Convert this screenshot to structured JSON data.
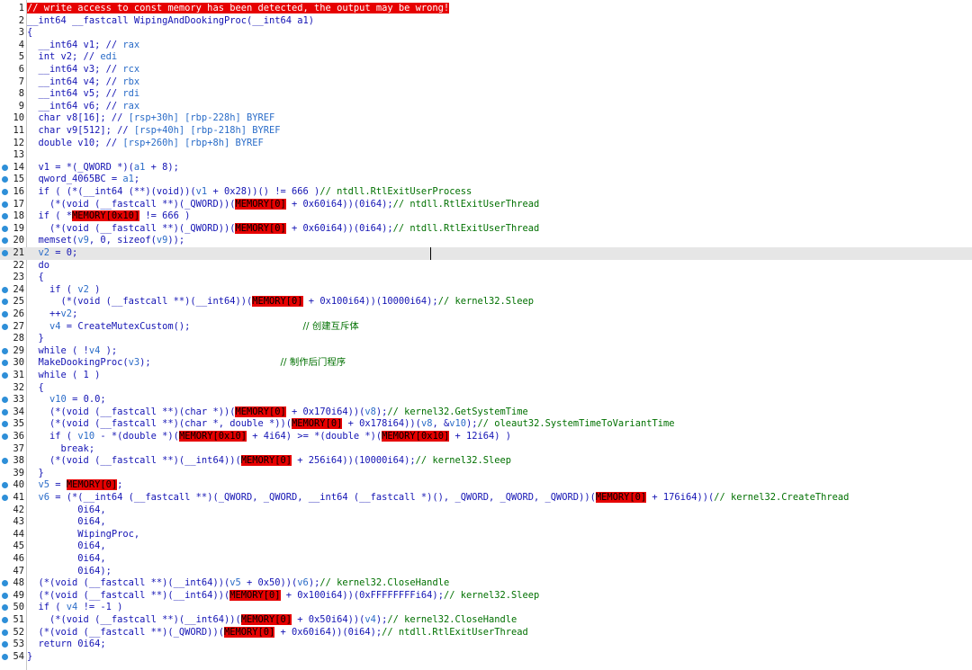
{
  "editor": {
    "title": "pseudocode",
    "lines": [
      {
        "n": "1",
        "dot": false,
        "cur": false,
        "parts": [
          {
            "t": "// write access to const memory has been detected, the output may be wrong!",
            "c": "banner"
          }
        ]
      },
      {
        "n": "2",
        "dot": false,
        "cur": false,
        "parts": [
          {
            "t": "__int64 __fastcall WipingAndDookingProc(__int64 a1)",
            "c": ""
          }
        ]
      },
      {
        "n": "3",
        "dot": false,
        "cur": false,
        "parts": [
          {
            "t": "{",
            "c": ""
          }
        ]
      },
      {
        "n": "4",
        "dot": false,
        "cur": false,
        "parts": [
          {
            "t": "  __int64 v1; // ",
            "c": ""
          },
          {
            "t": "rax",
            "c": "t-v"
          }
        ]
      },
      {
        "n": "5",
        "dot": false,
        "cur": false,
        "parts": [
          {
            "t": "  int v2; // ",
            "c": ""
          },
          {
            "t": "edi",
            "c": "t-v"
          }
        ]
      },
      {
        "n": "6",
        "dot": false,
        "cur": false,
        "parts": [
          {
            "t": "  __int64 v3; // ",
            "c": ""
          },
          {
            "t": "rcx",
            "c": "t-v"
          }
        ]
      },
      {
        "n": "7",
        "dot": false,
        "cur": false,
        "parts": [
          {
            "t": "  __int64 v4; // ",
            "c": ""
          },
          {
            "t": "rbx",
            "c": "t-v"
          }
        ]
      },
      {
        "n": "8",
        "dot": false,
        "cur": false,
        "parts": [
          {
            "t": "  __int64 v5; // ",
            "c": ""
          },
          {
            "t": "rdi",
            "c": "t-v"
          }
        ]
      },
      {
        "n": "9",
        "dot": false,
        "cur": false,
        "parts": [
          {
            "t": "  __int64 v6; // ",
            "c": ""
          },
          {
            "t": "rax",
            "c": "t-v"
          }
        ]
      },
      {
        "n": "10",
        "dot": false,
        "cur": false,
        "parts": [
          {
            "t": "  char v8[16]; // ",
            "c": ""
          },
          {
            "t": "[rsp+30h] [rbp-228h] BYREF",
            "c": "t-v"
          }
        ]
      },
      {
        "n": "11",
        "dot": false,
        "cur": false,
        "parts": [
          {
            "t": "  char v9[512]; // ",
            "c": ""
          },
          {
            "t": "[rsp+40h] [rbp-218h] BYREF",
            "c": "t-v"
          }
        ]
      },
      {
        "n": "12",
        "dot": false,
        "cur": false,
        "parts": [
          {
            "t": "  double v10; // ",
            "c": ""
          },
          {
            "t": "[rsp+260h] [rbp+8h] BYREF",
            "c": "t-v"
          }
        ]
      },
      {
        "n": "13",
        "dot": false,
        "cur": false,
        "parts": [
          {
            "t": "",
            "c": ""
          }
        ]
      },
      {
        "n": "14",
        "dot": true,
        "cur": false,
        "parts": [
          {
            "t": "  v1 = *(_QWORD *)(",
            "c": ""
          },
          {
            "t": "a1",
            "c": "t-v"
          },
          {
            "t": " + 8);",
            "c": ""
          }
        ]
      },
      {
        "n": "15",
        "dot": true,
        "cur": false,
        "parts": [
          {
            "t": "  qword_4065BC = ",
            "c": ""
          },
          {
            "t": "a1",
            "c": "t-v"
          },
          {
            "t": ";",
            "c": ""
          }
        ]
      },
      {
        "n": "16",
        "dot": true,
        "cur": false,
        "parts": [
          {
            "t": "  if ( (*(__int64 (**)(void))(",
            "c": ""
          },
          {
            "t": "v1",
            "c": "t-v"
          },
          {
            "t": " + 0x28))() != 666 )",
            "c": ""
          },
          {
            "t": "// ntdll.RtlExitUserProcess",
            "c": "t-c"
          }
        ]
      },
      {
        "n": "17",
        "dot": true,
        "cur": false,
        "parts": [
          {
            "t": "    (*(void (__fastcall **)(_QWORD))(",
            "c": ""
          },
          {
            "t": "MEMORY[0]",
            "c": "t-m"
          },
          {
            "t": " + 0x60i64))(0i64);",
            "c": ""
          },
          {
            "t": "// ntdll.RtlExitUserThread",
            "c": "t-c"
          }
        ]
      },
      {
        "n": "18",
        "dot": true,
        "cur": false,
        "parts": [
          {
            "t": "  if ( *",
            "c": ""
          },
          {
            "t": "MEMORY[0x10]",
            "c": "t-m"
          },
          {
            "t": " != 666 )",
            "c": ""
          }
        ]
      },
      {
        "n": "19",
        "dot": true,
        "cur": false,
        "parts": [
          {
            "t": "    (*(void (__fastcall **)(_QWORD))(",
            "c": ""
          },
          {
            "t": "MEMORY[0]",
            "c": "t-m"
          },
          {
            "t": " + 0x60i64))(0i64);",
            "c": ""
          },
          {
            "t": "// ntdll.RtlExitUserThread",
            "c": "t-c"
          }
        ]
      },
      {
        "n": "20",
        "dot": true,
        "cur": false,
        "parts": [
          {
            "t": "  memset(",
            "c": ""
          },
          {
            "t": "v9",
            "c": "t-v"
          },
          {
            "t": ", 0, sizeof(",
            "c": ""
          },
          {
            "t": "v9",
            "c": "t-v"
          },
          {
            "t": "));",
            "c": ""
          }
        ]
      },
      {
        "n": "21",
        "dot": true,
        "cur": true,
        "parts": [
          {
            "t": "  v2",
            "c": "t-v"
          },
          {
            "t": " = 0;",
            "c": ""
          }
        ]
      },
      {
        "n": "22",
        "dot": false,
        "cur": false,
        "parts": [
          {
            "t": "  do",
            "c": ""
          }
        ]
      },
      {
        "n": "23",
        "dot": false,
        "cur": false,
        "parts": [
          {
            "t": "  {",
            "c": ""
          }
        ]
      },
      {
        "n": "24",
        "dot": true,
        "cur": false,
        "parts": [
          {
            "t": "    if ( ",
            "c": ""
          },
          {
            "t": "v2",
            "c": "t-v"
          },
          {
            "t": " )",
            "c": ""
          }
        ]
      },
      {
        "n": "25",
        "dot": true,
        "cur": false,
        "parts": [
          {
            "t": "      (*(void (__fastcall **)(__int64))(",
            "c": ""
          },
          {
            "t": "MEMORY[0]",
            "c": "t-m"
          },
          {
            "t": " + 0x100i64))(10000i64);",
            "c": ""
          },
          {
            "t": "// kernel32.Sleep",
            "c": "t-c"
          }
        ]
      },
      {
        "n": "26",
        "dot": true,
        "cur": false,
        "parts": [
          {
            "t": "    ++",
            "c": ""
          },
          {
            "t": "v2",
            "c": "t-v"
          },
          {
            "t": ";",
            "c": ""
          }
        ]
      },
      {
        "n": "27",
        "dot": true,
        "cur": false,
        "parts": [
          {
            "t": "    ",
            "c": ""
          },
          {
            "t": "v4",
            "c": "t-v"
          },
          {
            "t": " = CreateMutexCustom();                    ",
            "c": ""
          },
          {
            "t": "// 创建互斥体",
            "c": "t-ch"
          }
        ]
      },
      {
        "n": "28",
        "dot": false,
        "cur": false,
        "parts": [
          {
            "t": "  }",
            "c": ""
          }
        ]
      },
      {
        "n": "29",
        "dot": true,
        "cur": false,
        "parts": [
          {
            "t": "  while ( !",
            "c": ""
          },
          {
            "t": "v4",
            "c": "t-v"
          },
          {
            "t": " );",
            "c": ""
          }
        ]
      },
      {
        "n": "30",
        "dot": true,
        "cur": false,
        "parts": [
          {
            "t": "  MakeDookingProc(",
            "c": ""
          },
          {
            "t": "v3",
            "c": "t-v"
          },
          {
            "t": ");                       ",
            "c": ""
          },
          {
            "t": "// 制作后门程序",
            "c": "t-ch"
          }
        ]
      },
      {
        "n": "31",
        "dot": true,
        "cur": false,
        "parts": [
          {
            "t": "  while ( 1 )",
            "c": ""
          }
        ]
      },
      {
        "n": "32",
        "dot": false,
        "cur": false,
        "parts": [
          {
            "t": "  {",
            "c": ""
          }
        ]
      },
      {
        "n": "33",
        "dot": true,
        "cur": false,
        "parts": [
          {
            "t": "    ",
            "c": ""
          },
          {
            "t": "v10",
            "c": "t-v"
          },
          {
            "t": " = 0.0;",
            "c": ""
          }
        ]
      },
      {
        "n": "34",
        "dot": true,
        "cur": false,
        "parts": [
          {
            "t": "    (*(void (__fastcall **)(char *))(",
            "c": ""
          },
          {
            "t": "MEMORY[0]",
            "c": "t-m"
          },
          {
            "t": " + 0x170i64))(",
            "c": ""
          },
          {
            "t": "v8",
            "c": "t-v"
          },
          {
            "t": ");",
            "c": ""
          },
          {
            "t": "// kernel32.GetSystemTime",
            "c": "t-c"
          }
        ]
      },
      {
        "n": "35",
        "dot": true,
        "cur": false,
        "parts": [
          {
            "t": "    (*(void (__fastcall **)(char *, double *))(",
            "c": ""
          },
          {
            "t": "MEMORY[0]",
            "c": "t-m"
          },
          {
            "t": " + 0x178i64))(",
            "c": ""
          },
          {
            "t": "v8",
            "c": "t-v"
          },
          {
            "t": ", &",
            "c": ""
          },
          {
            "t": "v10",
            "c": "t-v"
          },
          {
            "t": ");",
            "c": ""
          },
          {
            "t": "// oleaut32.SystemTimeToVariantTime",
            "c": "t-c"
          }
        ]
      },
      {
        "n": "36",
        "dot": true,
        "cur": false,
        "parts": [
          {
            "t": "    if ( ",
            "c": ""
          },
          {
            "t": "v10",
            "c": "t-v"
          },
          {
            "t": " - *(double *)(",
            "c": ""
          },
          {
            "t": "MEMORY[0x10]",
            "c": "t-m"
          },
          {
            "t": " + 4i64) >= *(double *)(",
            "c": ""
          },
          {
            "t": "MEMORY[0x10]",
            "c": "t-m"
          },
          {
            "t": " + 12i64) )",
            "c": ""
          }
        ]
      },
      {
        "n": "37",
        "dot": false,
        "cur": false,
        "parts": [
          {
            "t": "      break;",
            "c": ""
          }
        ]
      },
      {
        "n": "38",
        "dot": true,
        "cur": false,
        "parts": [
          {
            "t": "    (*(void (__fastcall **)(__int64))(",
            "c": ""
          },
          {
            "t": "MEMORY[0]",
            "c": "t-m"
          },
          {
            "t": " + 256i64))(10000i64);",
            "c": ""
          },
          {
            "t": "// kernel32.Sleep",
            "c": "t-c"
          }
        ]
      },
      {
        "n": "39",
        "dot": false,
        "cur": false,
        "parts": [
          {
            "t": "  }",
            "c": ""
          }
        ]
      },
      {
        "n": "40",
        "dot": true,
        "cur": false,
        "parts": [
          {
            "t": "  ",
            "c": ""
          },
          {
            "t": "v5",
            "c": "t-v"
          },
          {
            "t": " = ",
            "c": ""
          },
          {
            "t": "MEMORY[0]",
            "c": "t-m"
          },
          {
            "t": ";",
            "c": ""
          }
        ]
      },
      {
        "n": "41",
        "dot": true,
        "cur": false,
        "parts": [
          {
            "t": "  ",
            "c": ""
          },
          {
            "t": "v6",
            "c": "t-v"
          },
          {
            "t": " = (*(__int64 (__fastcall **)(_QWORD, _QWORD, __int64 (__fastcall *)(), _QWORD, _QWORD, _QWORD))(",
            "c": ""
          },
          {
            "t": "MEMORY[0]",
            "c": "t-m"
          },
          {
            "t": " + 176i64))(",
            "c": ""
          },
          {
            "t": "// kernel32.CreateThread",
            "c": "t-c"
          }
        ]
      },
      {
        "n": "42",
        "dot": false,
        "cur": false,
        "parts": [
          {
            "t": "         0i64,",
            "c": ""
          }
        ]
      },
      {
        "n": "43",
        "dot": false,
        "cur": false,
        "parts": [
          {
            "t": "         0i64,",
            "c": ""
          }
        ]
      },
      {
        "n": "44",
        "dot": false,
        "cur": false,
        "parts": [
          {
            "t": "         WipingProc,",
            "c": ""
          }
        ]
      },
      {
        "n": "45",
        "dot": false,
        "cur": false,
        "parts": [
          {
            "t": "         0i64,",
            "c": ""
          }
        ]
      },
      {
        "n": "46",
        "dot": false,
        "cur": false,
        "parts": [
          {
            "t": "         0i64,",
            "c": ""
          }
        ]
      },
      {
        "n": "47",
        "dot": false,
        "cur": false,
        "parts": [
          {
            "t": "         0i64);",
            "c": ""
          }
        ]
      },
      {
        "n": "48",
        "dot": true,
        "cur": false,
        "parts": [
          {
            "t": "  (*(void (__fastcall **)(__int64))(",
            "c": ""
          },
          {
            "t": "v5",
            "c": "t-v"
          },
          {
            "t": " + 0x50))(",
            "c": ""
          },
          {
            "t": "v6",
            "c": "t-v"
          },
          {
            "t": ");",
            "c": ""
          },
          {
            "t": "// kernel32.CloseHandle",
            "c": "t-c"
          }
        ]
      },
      {
        "n": "49",
        "dot": true,
        "cur": false,
        "parts": [
          {
            "t": "  (*(void (__fastcall **)(__int64))(",
            "c": ""
          },
          {
            "t": "MEMORY[0]",
            "c": "t-m"
          },
          {
            "t": " + 0x100i64))(0xFFFFFFFFi64);",
            "c": ""
          },
          {
            "t": "// kernel32.Sleep",
            "c": "t-c"
          }
        ]
      },
      {
        "n": "50",
        "dot": true,
        "cur": false,
        "parts": [
          {
            "t": "  if ( ",
            "c": ""
          },
          {
            "t": "v4",
            "c": "t-v"
          },
          {
            "t": " != -1 )",
            "c": ""
          }
        ]
      },
      {
        "n": "51",
        "dot": true,
        "cur": false,
        "parts": [
          {
            "t": "    (*(void (__fastcall **)(__int64))(",
            "c": ""
          },
          {
            "t": "MEMORY[0]",
            "c": "t-m"
          },
          {
            "t": " + 0x50i64))(",
            "c": ""
          },
          {
            "t": "v4",
            "c": "t-v"
          },
          {
            "t": ");",
            "c": ""
          },
          {
            "t": "// kernel32.CloseHandle",
            "c": "t-c"
          }
        ]
      },
      {
        "n": "52",
        "dot": true,
        "cur": false,
        "parts": [
          {
            "t": "  (*(void (__fastcall **)(_QWORD))(",
            "c": ""
          },
          {
            "t": "MEMORY[0]",
            "c": "t-m"
          },
          {
            "t": " + 0x60i64))(0i64);",
            "c": ""
          },
          {
            "t": "// ntdll.RtlExitUserThread",
            "c": "t-c"
          }
        ]
      },
      {
        "n": "53",
        "dot": true,
        "cur": false,
        "parts": [
          {
            "t": "  return 0i64;",
            "c": ""
          }
        ]
      },
      {
        "n": "54",
        "dot": true,
        "cur": false,
        "parts": [
          {
            "t": "}",
            "c": ""
          }
        ]
      }
    ]
  },
  "colors": {
    "background": "#ffffff",
    "code_text": "#1414b4",
    "comment": "#007000",
    "variable": "#2a6cc8",
    "memory_highlight": "#e60000",
    "breakpoint_dot": "#2e8fd8",
    "current_line": "#e6e6e6"
  }
}
